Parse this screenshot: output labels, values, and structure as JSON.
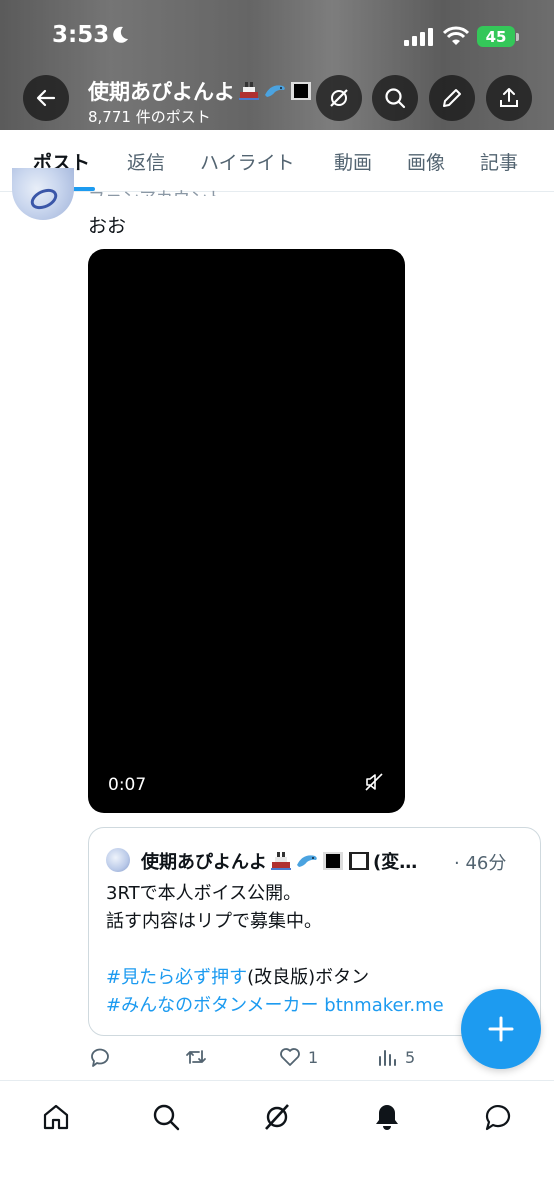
{
  "status_bar": {
    "time": "3:53",
    "battery": "45"
  },
  "header": {
    "name": "使期あぴよんよ",
    "post_count": "8,771 件のポスト"
  },
  "tabs": [
    "ポスト",
    "返信",
    "ハイライト",
    "動画",
    "画像",
    "記事"
  ],
  "tweet": {
    "cut_line": "ファンアカウント",
    "text": "おお",
    "video_duration": "0:07",
    "quote": {
      "name": "使期あぴよんよ",
      "name_suffix": "(変…",
      "time": "· 46分",
      "lines": [
        "3RTで本人ボイス公開。",
        "話す内容はリプで募集中。",
        ""
      ],
      "hashtag1": "#見たら必ず押す",
      "hashtag1_rest": "(改良版)ボタン",
      "hashtag2": "#みんなのボタンメーカー",
      "link": "btnmaker.me"
    },
    "likes": "1",
    "views": "5"
  },
  "colors": {
    "accent": "#1d9bf0",
    "battery": "#34c759"
  },
  "icons": {
    "header": [
      "back-arrow-icon",
      "grok-icon",
      "search-icon",
      "pencil-icon",
      "share-icon"
    ],
    "bottom_nav": [
      "home-icon",
      "search-icon",
      "grok-icon",
      "bell-icon",
      "messages-icon"
    ]
  }
}
